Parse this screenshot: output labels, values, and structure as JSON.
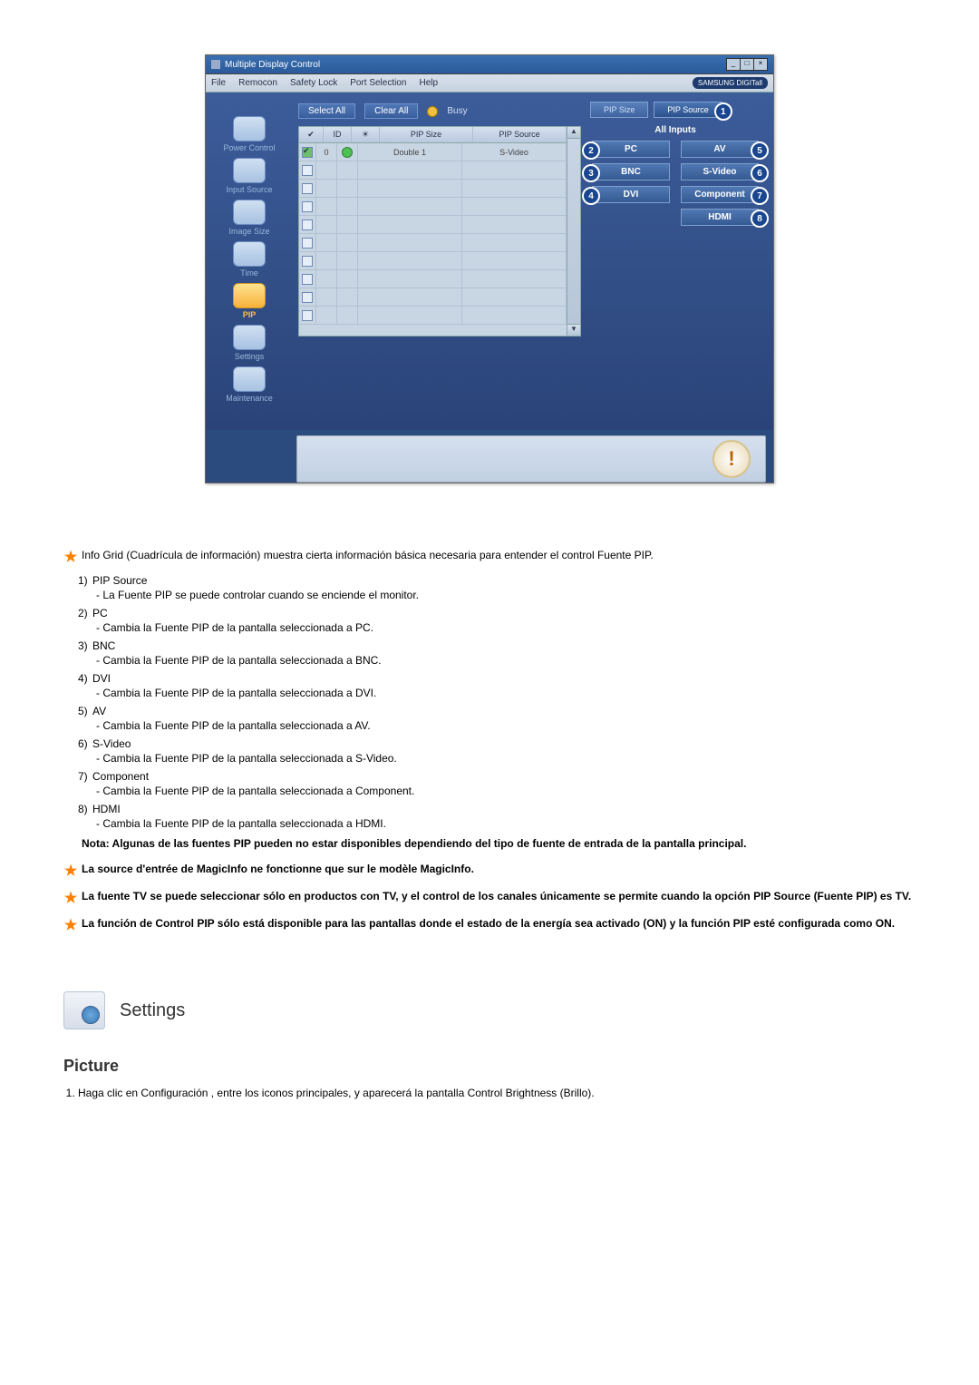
{
  "app": {
    "title": "Multiple Display Control",
    "menus": [
      "File",
      "Remocon",
      "Safety Lock",
      "Port Selection",
      "Help"
    ],
    "brand": "SAMSUNG DIGITall"
  },
  "sidebar": {
    "items": [
      {
        "label": "Power Control"
      },
      {
        "label": "Input Source"
      },
      {
        "label": "Image Size"
      },
      {
        "label": "Time"
      },
      {
        "label": "PIP"
      },
      {
        "label": "Settings"
      },
      {
        "label": "Maintenance"
      }
    ]
  },
  "toolbar": {
    "selectAll": "Select All",
    "clearAll": "Clear All",
    "busy": "Busy"
  },
  "grid": {
    "headers": {
      "id": "ID",
      "size": "PIP Size",
      "source": "PIP Source"
    },
    "row": {
      "id": "0",
      "size": "Double 1",
      "source": "S-Video"
    }
  },
  "right": {
    "tabSize": "PIP Size",
    "tabSource": "PIP Source",
    "allInputs": "All Inputs",
    "btns": {
      "pc": "PC",
      "av": "AV",
      "bnc": "BNC",
      "svideo": "S-Video",
      "dvi": "DVI",
      "component": "Component",
      "hdmi": "HDMI"
    },
    "nums": {
      "src": "1",
      "pc": "2",
      "bnc": "3",
      "dvi": "4",
      "av": "5",
      "svideo": "6",
      "component": "7",
      "hdmi": "8"
    }
  },
  "doc": {
    "lead": "Info Grid (Cuadrícula de información) muestra cierta información básica necesaria para entender el control Fuente PIP.",
    "items": [
      {
        "n": "1)",
        "t": "PIP Source",
        "s": "- La Fuente PIP se puede controlar cuando se enciende el monitor."
      },
      {
        "n": "2)",
        "t": "PC",
        "s": "- Cambia la Fuente PIP de la pantalla seleccionada a PC."
      },
      {
        "n": "3)",
        "t": "BNC",
        "s": "- Cambia la Fuente PIP de la pantalla seleccionada a BNC."
      },
      {
        "n": "4)",
        "t": "DVI",
        "s": "- Cambia la Fuente PIP de la pantalla seleccionada a DVI."
      },
      {
        "n": "5)",
        "t": "AV",
        "s": "- Cambia la Fuente PIP de la pantalla seleccionada a AV."
      },
      {
        "n": "6)",
        "t": "S-Video",
        "s": "- Cambia la Fuente PIP de la pantalla seleccionada a S-Video."
      },
      {
        "n": "7)",
        "t": "Component",
        "s": "- Cambia la Fuente PIP de la pantalla seleccionada a Component."
      },
      {
        "n": "8)",
        "t": "HDMI",
        "s": "- Cambia la Fuente PIP de la pantalla seleccionada a HDMI."
      }
    ],
    "note": "Nota: Algunas de las fuentes PIP pueden no estar disponibles dependiendo del tipo de fuente de entrada de la pantalla principal.",
    "stars": [
      "La source d'entrée de MagicInfo ne fonctionne que sur le modèle MagicInfo.",
      "La fuente TV se puede seleccionar sólo en productos con TV, y el control de los canales únicamente se permite cuando la opción PIP Source (Fuente PIP) es TV.",
      "La función de Control PIP sólo está disponible para las pantallas donde el estado de la energía sea activado (ON) y la función PIP esté configurada como ON."
    ],
    "settings": "Settings",
    "picture": "Picture",
    "step1": "Haga clic en Configuración , entre los iconos principales, y aparecerá la pantalla Control Brightness (Brillo)."
  }
}
